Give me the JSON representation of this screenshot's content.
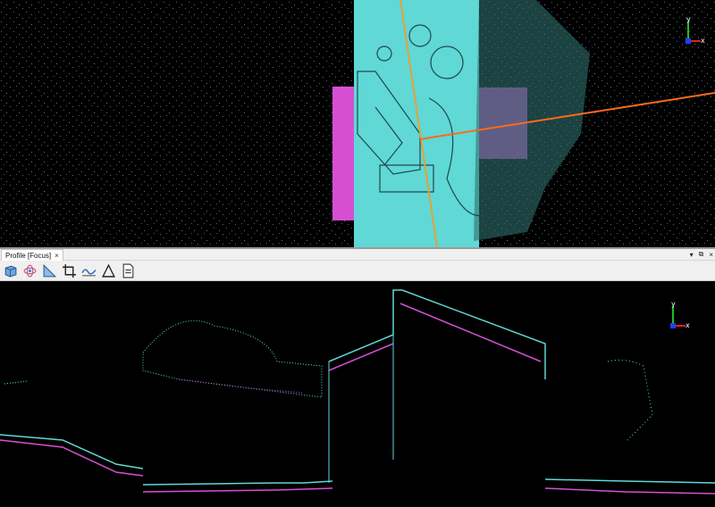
{
  "panel": {
    "tab_label": "Profile [Focus]",
    "close_glyph": "×",
    "controls": [
      "▾",
      "⧉",
      "×"
    ]
  },
  "toolbar": {
    "buttons": [
      {
        "name": "3d-box-view",
        "icon": "cube-icon"
      },
      {
        "name": "rotate-view",
        "icon": "orbit-icon"
      },
      {
        "name": "slope-measure",
        "icon": "ruler-triangle-icon"
      },
      {
        "name": "crop-extent",
        "icon": "crop-icon"
      },
      {
        "name": "section-profile",
        "icon": "profile-wave-icon"
      },
      {
        "name": "angle-measure",
        "icon": "triangle-icon"
      },
      {
        "name": "report",
        "icon": "document-icon"
      }
    ]
  },
  "axes": {
    "y": "y",
    "x": "x"
  },
  "colors": {
    "background": "#000000",
    "cyan_points": "#5fd8d6",
    "magenta_points": "#d64fd3",
    "section_line": "#e2a23a",
    "profile_line": "#ff6a1a"
  }
}
